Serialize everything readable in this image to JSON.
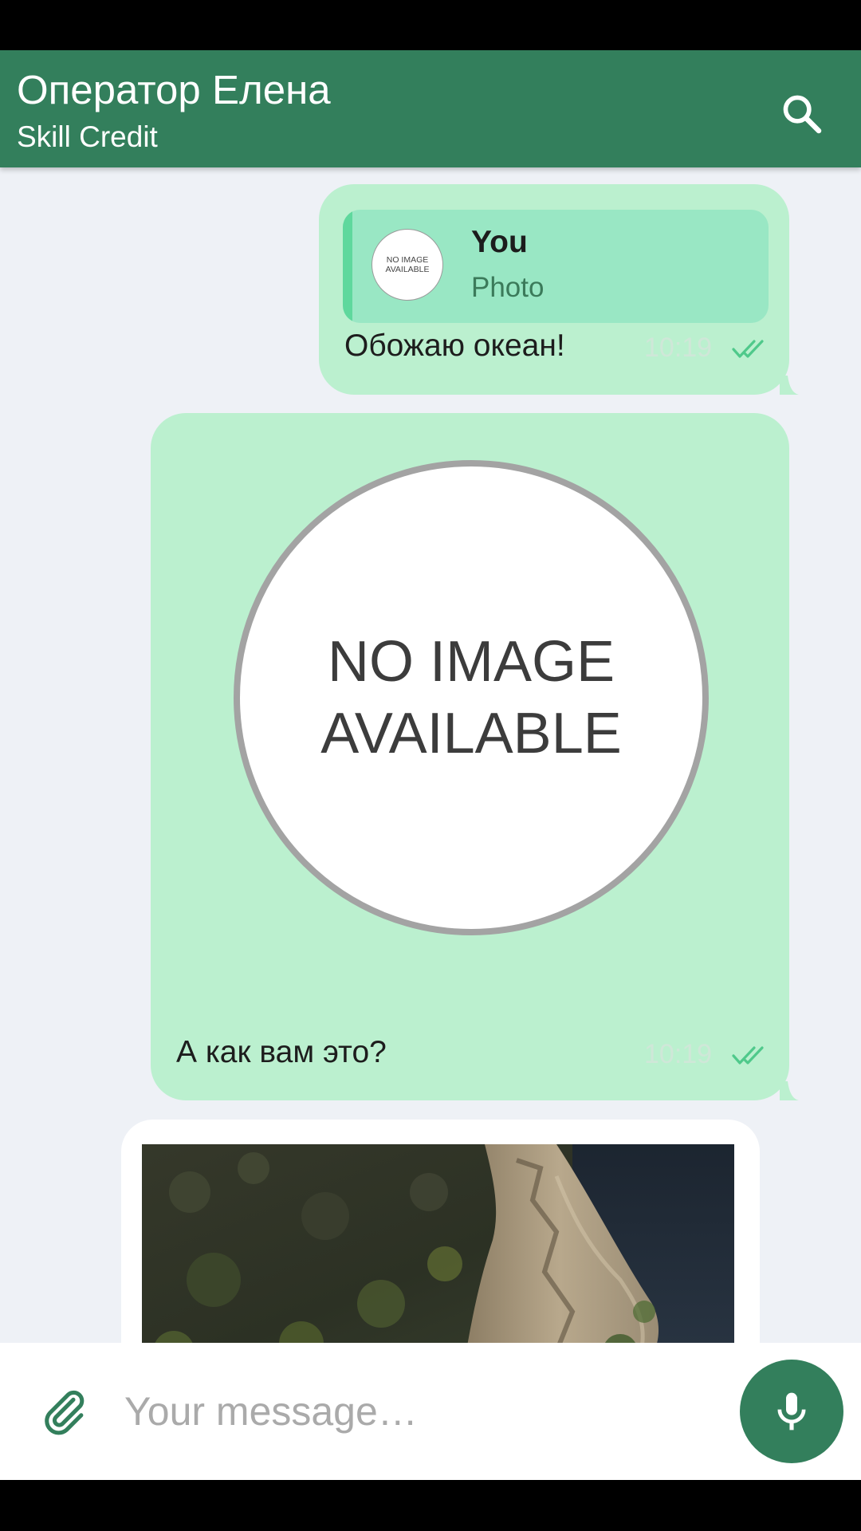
{
  "header": {
    "title": "Оператор Елена",
    "subtitle": "Skill Credit",
    "search_icon": "search-icon"
  },
  "messages": [
    {
      "direction": "outgoing",
      "reply": {
        "author": "You",
        "kind": "Photo",
        "thumb_line1": "NO IMAGE",
        "thumb_line2": "AVAILABLE"
      },
      "text": "Обожаю океан!",
      "time": "10:19",
      "status_icon": "double-check-icon"
    },
    {
      "direction": "outgoing",
      "image_line1": "NO IMAGE",
      "image_line2": "AVAILABLE",
      "text": "А как вам это?",
      "time": "10:19",
      "status_icon": "double-check-icon"
    },
    {
      "direction": "incoming",
      "image": "landscape-photo"
    }
  ],
  "composer": {
    "placeholder": "Your message…",
    "attach_icon": "paperclip-icon",
    "mic_icon": "microphone-icon"
  },
  "colors": {
    "app_bar": "#337f5c",
    "outgoing_bubble": "#bbf0cf",
    "reply_quote": "#99e7c4",
    "reply_bar": "#5fd89d",
    "chat_background": "#eef1f6",
    "check_marks": "#4fc98b"
  }
}
